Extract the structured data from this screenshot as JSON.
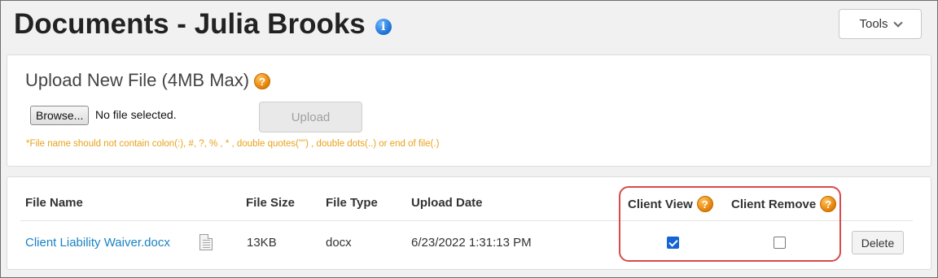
{
  "header": {
    "title": "Documents - Julia Brooks",
    "info_icon_glyph": "i",
    "tools_label": "Tools"
  },
  "upload": {
    "title": "Upload New File (4MB Max)",
    "help_glyph": "?",
    "browse_label": "Browse...",
    "file_status": "No file selected.",
    "upload_label": "Upload",
    "hint": "*File name should not contain colon(:), #, ?, % , * , double quotes(\"\") , double dots(..) or end of file(.)"
  },
  "table": {
    "columns": {
      "file_name": "File Name",
      "file_size": "File Size",
      "file_type": "File Type",
      "upload_date": "Upload Date",
      "client_view": "Client View",
      "client_remove": "Client Remove"
    },
    "help_glyph": "?",
    "rows": [
      {
        "file_name": "Client Liability Waiver.docx",
        "file_size": "13KB",
        "file_type": "docx",
        "upload_date": "6/23/2022 1:31:13 PM",
        "client_view": true,
        "client_remove": false,
        "delete_label": "Delete"
      }
    ]
  },
  "colors": {
    "accent_link": "#1a82c4",
    "hint_text": "#e8a21a",
    "highlight_outline": "#d94a4a",
    "checkbox_checked": "#1464d6"
  },
  "icons": {
    "title_info": "info-icon",
    "help": "help-icon",
    "tools_menu": "chevron-down-icon",
    "file_row": "document-icon"
  }
}
